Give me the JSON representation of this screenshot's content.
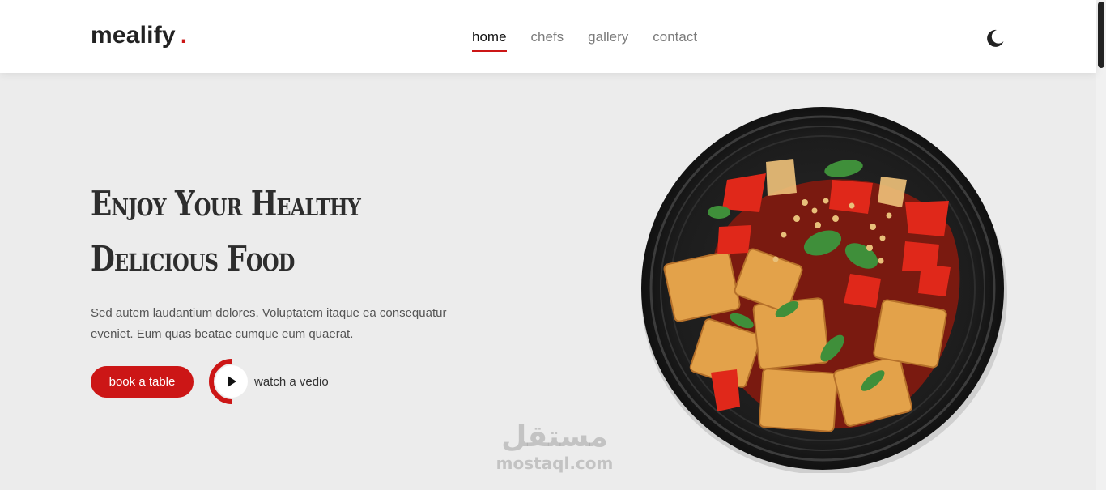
{
  "brand": {
    "name": "mealify",
    "dot": ".",
    "accent": "#cc1616"
  },
  "nav": {
    "items": [
      {
        "label": "home",
        "active": true
      },
      {
        "label": "chefs",
        "active": false
      },
      {
        "label": "gallery",
        "active": false
      },
      {
        "label": "contact",
        "active": false
      }
    ],
    "theme_toggle_icon": "moon-icon"
  },
  "hero": {
    "title_line1": "Enjoy Your Healthy",
    "title_line2": "Delicious Food",
    "description": "Sed autem laudantium dolores. Voluptatem itaque ea consequatur eveniet. Eum quas beatae cumque eum quaerat.",
    "book_button": "book a table",
    "watch_label": "watch a vedio",
    "play_icon": "play-icon",
    "image_subject": "plate-of-food"
  },
  "watermark": {
    "arabic": "مستقل",
    "latin": "mostaql.com"
  },
  "colors": {
    "background": "#ececec",
    "header": "#ffffff",
    "text": "#2d2d2d"
  }
}
